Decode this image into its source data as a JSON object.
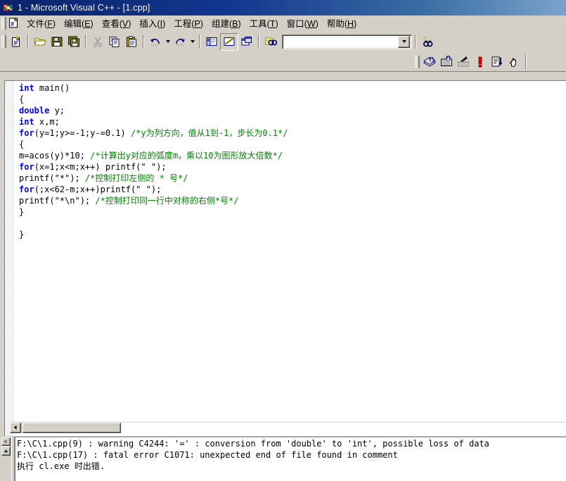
{
  "window": {
    "title": "1 - Microsoft Visual C++ - [1.cpp]",
    "app_icon": "vcpp-icon"
  },
  "menubar": {
    "doc_icon": "document-icon",
    "items": [
      {
        "label": "文件",
        "accel": "F"
      },
      {
        "label": "编辑",
        "accel": "E"
      },
      {
        "label": "查看",
        "accel": "V"
      },
      {
        "label": "插入",
        "accel": "I"
      },
      {
        "label": "工程",
        "accel": "P"
      },
      {
        "label": "组建",
        "accel": "B"
      },
      {
        "label": "工具",
        "accel": "T"
      },
      {
        "label": "窗口",
        "accel": "W"
      },
      {
        "label": "帮助",
        "accel": "H"
      }
    ]
  },
  "toolbar_standard": {
    "buttons": [
      {
        "name": "new-text-file-icon"
      },
      {
        "name": "open-folder-icon"
      },
      {
        "name": "save-icon"
      },
      {
        "name": "save-all-icon"
      },
      {
        "name": "cut-scissors-icon"
      },
      {
        "name": "copy-icon"
      },
      {
        "name": "paste-icon"
      },
      {
        "name": "undo-icon"
      },
      {
        "name": "redo-icon"
      },
      {
        "name": "workspace-icon"
      },
      {
        "name": "output-window-icon"
      },
      {
        "name": "window-list-icon"
      },
      {
        "name": "find-in-files-icon"
      }
    ],
    "search_combo": {
      "value": "",
      "placeholder": ""
    },
    "help_search_icon": "find-help-binoculars-icon"
  },
  "toolbar_build": {
    "buttons": [
      {
        "name": "compile-icon"
      },
      {
        "name": "build-icon"
      },
      {
        "name": "stop-build-icon"
      },
      {
        "name": "execute-program-icon"
      },
      {
        "name": "go-debug-icon"
      },
      {
        "name": "insert-remove-breakpoint-icon"
      }
    ]
  },
  "editor": {
    "filename": "1.cpp",
    "lines": [
      [
        {
          "t": "int",
          "c": "kw"
        },
        {
          "t": " main()",
          "c": ""
        }
      ],
      [
        {
          "t": "{",
          "c": ""
        }
      ],
      [
        {
          "t": "double",
          "c": "kw"
        },
        {
          "t": " y;",
          "c": ""
        }
      ],
      [
        {
          "t": "int",
          "c": "kw"
        },
        {
          "t": " x,m;",
          "c": ""
        }
      ],
      [
        {
          "t": "for",
          "c": "kw"
        },
        {
          "t": "(y=1;y>=-1;y-=0.1) ",
          "c": ""
        },
        {
          "t": "/*y为列方向，值从1到-1，步长为0.1*/",
          "c": "cmt"
        }
      ],
      [
        {
          "t": "{",
          "c": ""
        }
      ],
      [
        {
          "t": "m=acos(y)*10; ",
          "c": ""
        },
        {
          "t": "/*计算出y对应的弧度m，乘以10为图形放大倍数*/",
          "c": "cmt"
        }
      ],
      [
        {
          "t": "for",
          "c": "kw"
        },
        {
          "t": "(x=1;x<m;x++) printf(\" \");",
          "c": ""
        }
      ],
      [
        {
          "t": "printf(\"*\"); ",
          "c": ""
        },
        {
          "t": "/*控制打印左侧的 * 号*/",
          "c": "cmt"
        }
      ],
      [
        {
          "t": "for",
          "c": "kw"
        },
        {
          "t": "(;x<62-m;x++)printf(\" \");",
          "c": ""
        }
      ],
      [
        {
          "t": "printf(\"*\\n\"); ",
          "c": ""
        },
        {
          "t": "/*控制打印同一行中对称的右侧*号*/",
          "c": "cmt"
        }
      ],
      [
        {
          "t": "}",
          "c": ""
        }
      ],
      [
        {
          "t": "",
          "c": ""
        }
      ],
      [
        {
          "t": "}",
          "c": ""
        }
      ]
    ],
    "hscroll": {
      "left_arrow_icon": "scroll-left-arrow-icon",
      "thumb": "hscroll-thumb"
    },
    "colors": {
      "keyword": "#0000ff",
      "comment": "#008000",
      "text": "#000000",
      "background": "#ffffff"
    }
  },
  "output": {
    "close_icon_label": "×",
    "up_arrow_icon": "scroll-up-arrow-icon",
    "lines": [
      "F:\\C\\1.cpp(9) : warning C4244: '=' : conversion from 'double' to 'int', possible loss of data",
      "F:\\C\\1.cpp(17) : fatal error C1071: unexpected end of file found in comment",
      "执行 cl.exe 时出错."
    ]
  },
  "theme": {
    "face": "#d4d0c8",
    "titlebar_start": "#0a246a",
    "titlebar_end": "#7ba2cc",
    "shadow": "#808080",
    "highlight": "#ffffff"
  }
}
